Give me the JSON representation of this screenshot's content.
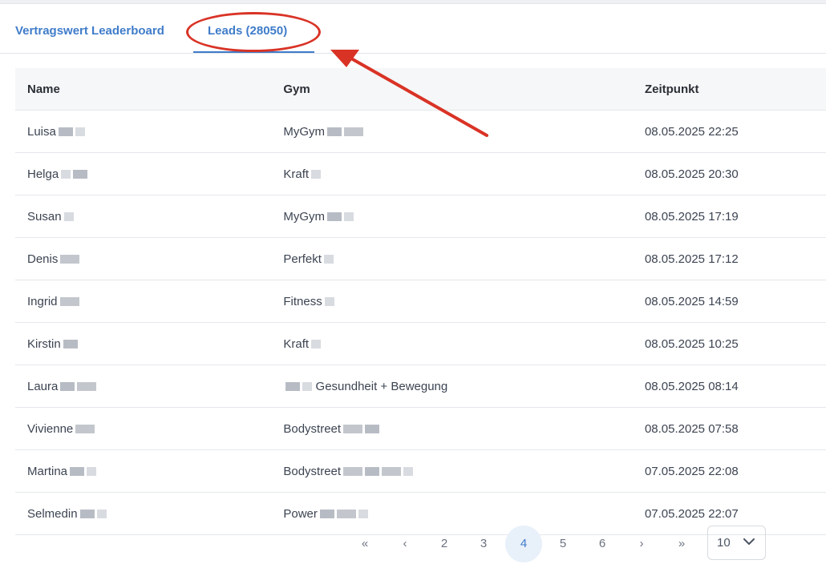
{
  "tabs": [
    {
      "label": "Vertragswert Leaderboard",
      "active": false
    },
    {
      "label": "Leads (28050)",
      "active": true
    }
  ],
  "table": {
    "headers": [
      "Name",
      "Gym",
      "Zeitpunkt"
    ],
    "rows": [
      {
        "name": "Luisa",
        "gym": "MyGym",
        "time": "08.05.2025 22:25"
      },
      {
        "name": "Helga",
        "gym": "Kraft",
        "time": "08.05.2025 20:30"
      },
      {
        "name": "Susan",
        "gym": "MyGym",
        "time": "08.05.2025 17:19"
      },
      {
        "name": "Denis",
        "gym": "Perfekt",
        "time": "08.05.2025 17:12"
      },
      {
        "name": "Ingrid",
        "gym": "Fitness",
        "time": "08.05.2025 14:59"
      },
      {
        "name": "Kirstin",
        "gym": "Kraft",
        "time": "08.05.2025 10:25"
      },
      {
        "name": "Laura",
        "gym": "Gesundheit + Bewegung",
        "time": "08.05.2025 08:14"
      },
      {
        "name": "Vivienne",
        "gym": "Bodystreet",
        "time": "08.05.2025 07:58"
      },
      {
        "name": "Martina",
        "gym": "Bodystreet",
        "time": "07.05.2025 22:08"
      },
      {
        "name": "Selmedin",
        "gym": "Power",
        "time": "07.05.2025 22:07"
      }
    ]
  },
  "pagination": {
    "first": "«",
    "prev": "‹",
    "pages": [
      "2",
      "3",
      "4",
      "5",
      "6"
    ],
    "current": "4",
    "next": "›",
    "last": "»",
    "page_size": "10"
  },
  "colors": {
    "accent": "#3f7cc9",
    "annotation": "#d93326"
  },
  "icons": {
    "page_size_toggle": "chevron-down-icon"
  }
}
